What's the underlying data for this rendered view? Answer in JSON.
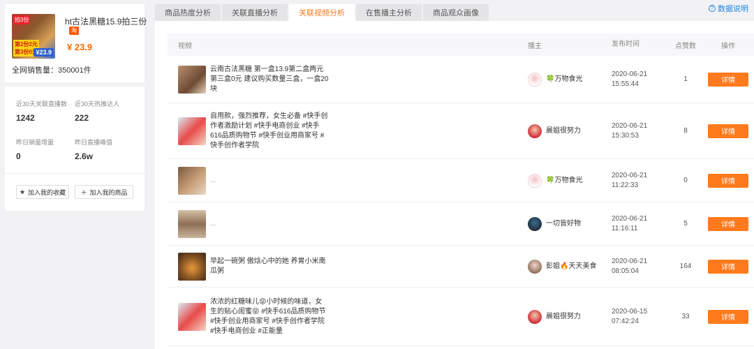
{
  "product": {
    "title": "ht古法黑糖15.9拍三份",
    "badge": "淘",
    "price": "¥ 23.9",
    "sales_total": "全网销售量：350001件",
    "thumb_tag_top": "拍3份",
    "thumb_tag_mid": "第2份2元",
    "thumb_tag_bottom": "第3份0元",
    "thumb_price": "¥23.9"
  },
  "stats": {
    "related_live_label": "近30天关联直播数",
    "related_live_value": "1242",
    "hot_push_label": "近30天热推达人",
    "hot_push_value": "222",
    "yesterday_sales_label": "昨日销量增量",
    "yesterday_sales_value": "0",
    "yesterday_peak_label": "昨日直播峰值",
    "yesterday_peak_value": "2.6w"
  },
  "actions": {
    "favorite_label": "加入我的收藏",
    "add_product_label": "加入我的商品"
  },
  "tabs": [
    "商品热度分析",
    "关联直播分析",
    "关联视频分析",
    "在售播主分析",
    "商品观众画像"
  ],
  "help_label": "数据说明",
  "table": {
    "headers": {
      "video": "视频",
      "anchor": "播主",
      "time": "发布时间",
      "likes": "点赞数",
      "op": "操作"
    },
    "detail_label": "详情",
    "rows": [
      {
        "text": "云南古法黑糖 第一盒13.9第二盒两元第三盒0元 建议购买数量三盒，一盒20块",
        "anchor": "🍀万物食光",
        "date": "2020-06-21",
        "time": "15:55:44",
        "likes": "1"
      },
      {
        "text": "自用款，强烈推荐，女生必备 #快手创作者激励计划 #快手电商创业 #快手616品质购物节 #快手创业用商家号 #快手创作者学院",
        "anchor": "晨姐很努力",
        "date": "2020-06-21",
        "time": "15:30:53",
        "likes": "8"
      },
      {
        "text": "...",
        "anchor": "🍀万物食光",
        "date": "2020-06-21",
        "time": "11:22:33",
        "likes": "0"
      },
      {
        "text": "...",
        "anchor": "一切皆好物",
        "date": "2020-06-21",
        "time": "11:16:11",
        "likes": "5"
      },
      {
        "text": "早起一碗粥 傲焓心中的她 养胃小米南瓜粥",
        "anchor": "彭姐🔥天天美食",
        "date": "2020-06-21",
        "time": "08:05:04",
        "likes": "164"
      },
      {
        "text": "浓浓的红糖味儿😝小时候的味道，女生的贴心闺蜜😝 #快手616品质购物节 #快手创业用商家号 #快手创作者学院 #快手电商创业 #正能量",
        "anchor": "晨姐很努力",
        "date": "2020-06-15",
        "time": "07:42:24",
        "likes": "33"
      }
    ]
  }
}
